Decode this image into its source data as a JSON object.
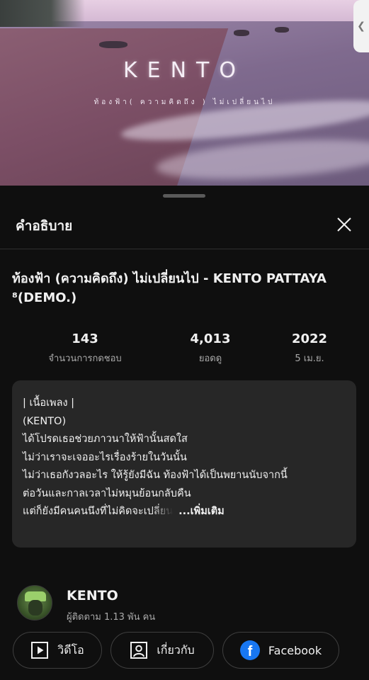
{
  "video": {
    "title": "KENTO",
    "subtitle": "ท้องฟ้า( ความคิดถึง ) ไม่เปลี่ยนไป"
  },
  "sheet": {
    "title": "คำอธิบาย"
  },
  "song": {
    "title": "ท้องฟ้า (ความคิดถึง) ไม่เปลี่ยนไป  -  KENTO PATTAYA ⁸(DEMO.)"
  },
  "stats": [
    {
      "value": "143",
      "label": "จำนวนการกดชอบ"
    },
    {
      "value": "4,013",
      "label": "ยอดดู"
    },
    {
      "value": "2022",
      "label": "5 เม.ย."
    }
  ],
  "description": {
    "lines": [
      "|  เนื้อเพลง  |",
      "(KENTO)",
      "ได้โปรดเธอช่วยภาวนาให้ฟ้านั้นสดใส",
      "ไม่ว่าเราจะเจออะไรเรื่องร้ายในวันนั้น",
      "ไม่ว่าเธอกังวลอะไร ให้รู้ยังมีฉัน ท้องฟ้าได้เป็นพยานนับจากนี้",
      "ต่อวันและกาลเวลาไม่หมุนย้อนกลับคืน",
      " แต่ก็ยังมีคนคนนึงที่ไม่คิดจะเปลี่ยน"
    ],
    "more_label": "...เพิ่มเติม"
  },
  "channel": {
    "name": "KENTO",
    "subscribers": "ผู้ติดตาม 1.13 พัน คน"
  },
  "links": {
    "videos_label": "วิดีโอ",
    "about_label": "เกี่ยวกับ",
    "facebook_label": "Facebook"
  },
  "colors": {
    "background": "#0f0f0f",
    "card": "#272727",
    "facebook": "#1877f2"
  }
}
